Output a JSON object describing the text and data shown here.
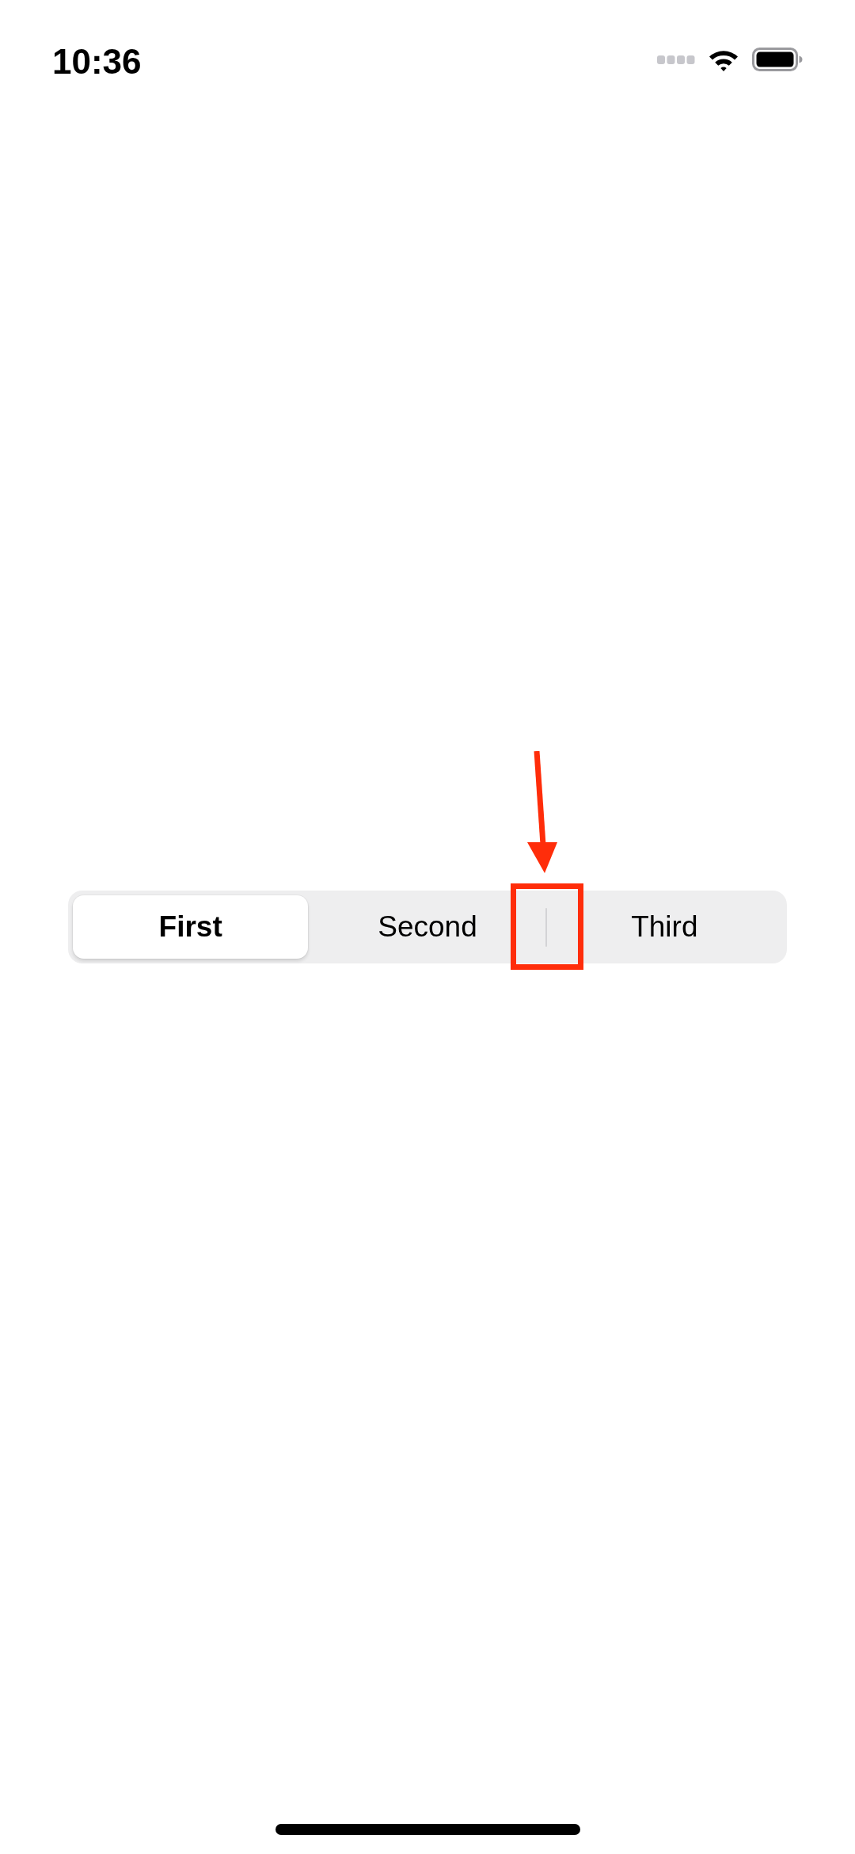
{
  "status_bar": {
    "time": "10:36"
  },
  "segmented_control": {
    "segments": [
      {
        "label": "First",
        "selected": true
      },
      {
        "label": "Second",
        "selected": false
      },
      {
        "label": "Third",
        "selected": false
      }
    ]
  }
}
